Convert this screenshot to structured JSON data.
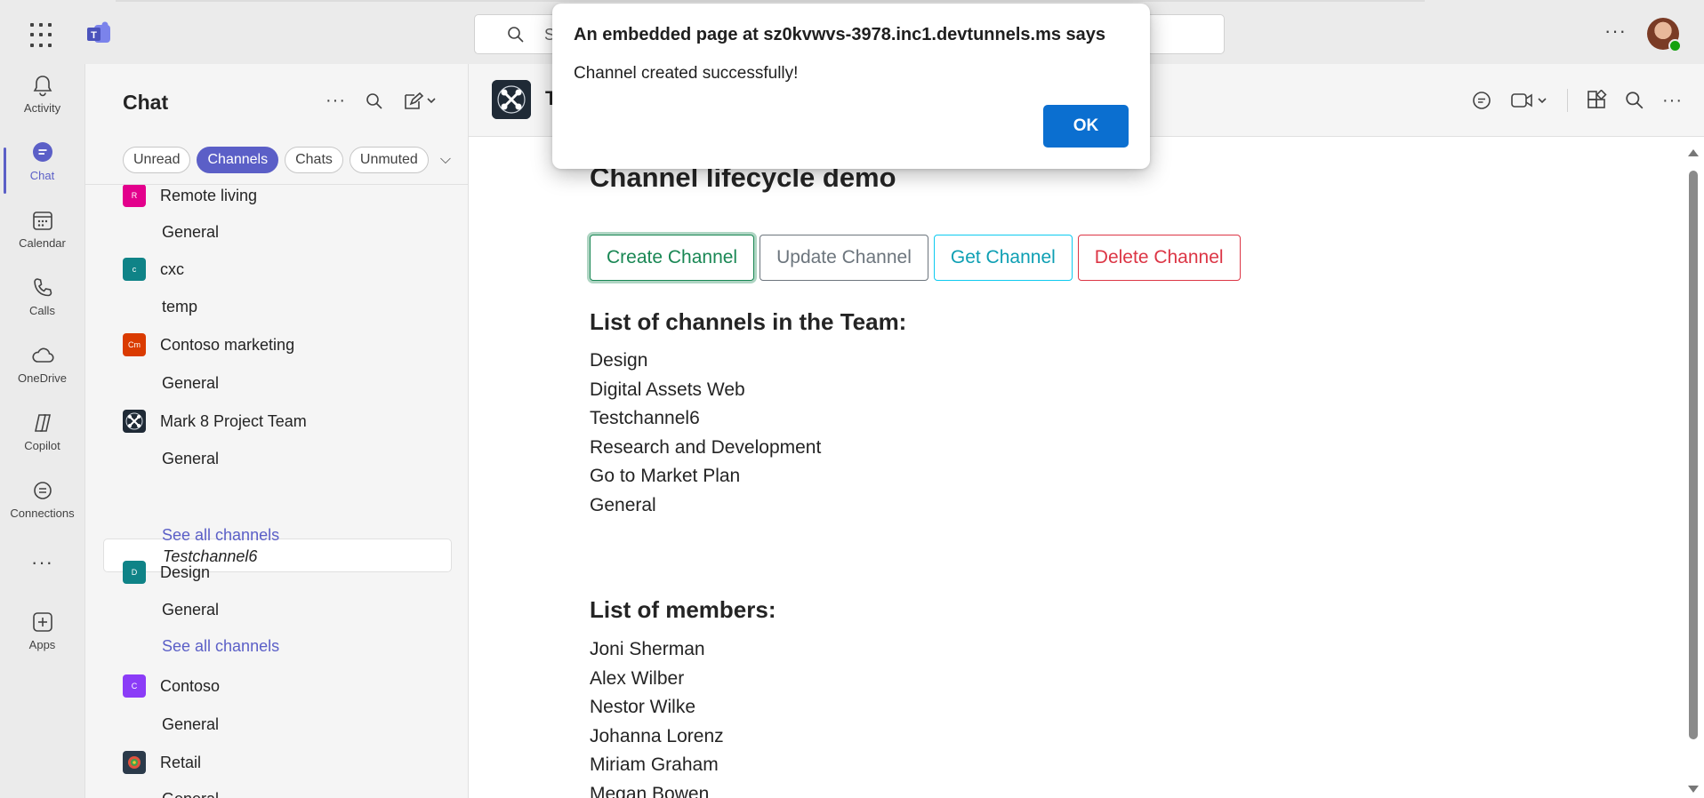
{
  "topbar": {
    "search_placeholder": "S"
  },
  "rail": {
    "items": [
      {
        "label": "Activity"
      },
      {
        "label": "Chat"
      },
      {
        "label": "Calendar"
      },
      {
        "label": "Calls"
      },
      {
        "label": "OneDrive"
      },
      {
        "label": "Copilot"
      },
      {
        "label": "Connections"
      },
      {
        "label": "Apps"
      }
    ]
  },
  "pane": {
    "title": "Chat",
    "filters": [
      "Unread",
      "Channels",
      "Chats",
      "Unmuted"
    ],
    "entries": [
      {
        "team": "Remote living",
        "initials": "R",
        "color": "#e3008c"
      },
      {
        "channel": "General"
      },
      {
        "team": "cxc",
        "initials": "c",
        "color": "#0f8387"
      },
      {
        "channel": "temp"
      },
      {
        "team": "Contoso marketing",
        "initials": "Cm",
        "color": "#da3b01"
      },
      {
        "channel": "General"
      },
      {
        "team": "Mark 8 Project Team"
      },
      {
        "channel": "General"
      },
      {
        "channel": "Testchannel6"
      },
      {
        "link": "See all channels"
      },
      {
        "team": "Design",
        "initials": "D",
        "color": "#0f8387"
      },
      {
        "channel": "General"
      },
      {
        "link": "See all channels"
      },
      {
        "team": "Contoso",
        "initials": "C",
        "color": "#8b3cf7"
      },
      {
        "channel": "General"
      },
      {
        "team": "Retail"
      },
      {
        "channel": "General"
      }
    ]
  },
  "main": {
    "header_title": "T",
    "page_title": "Channel lifecycle demo",
    "buttons": {
      "create": "Create Channel",
      "update": "Update Channel",
      "get": "Get Channel",
      "delete": "Delete Channel"
    },
    "channels_heading": "List of channels in the Team:",
    "channels": [
      "Design",
      "Digital Assets Web",
      "Testchannel6",
      "Research and Development",
      "Go to Market Plan",
      "General"
    ],
    "members_heading": "List of members:",
    "members": [
      "Joni Sherman",
      "Alex Wilber",
      "Nestor Wilke",
      "Johanna Lorenz",
      "Miriam Graham",
      "Megan Bowen"
    ]
  },
  "dialog": {
    "title": "An embedded page at sz0kvwvs-3978.inc1.devtunnels.ms says",
    "message": "Channel created successfully!",
    "ok_label": "OK"
  },
  "colors": {
    "accent": "#5b5fc7",
    "ok_button": "#0b6fd0"
  }
}
